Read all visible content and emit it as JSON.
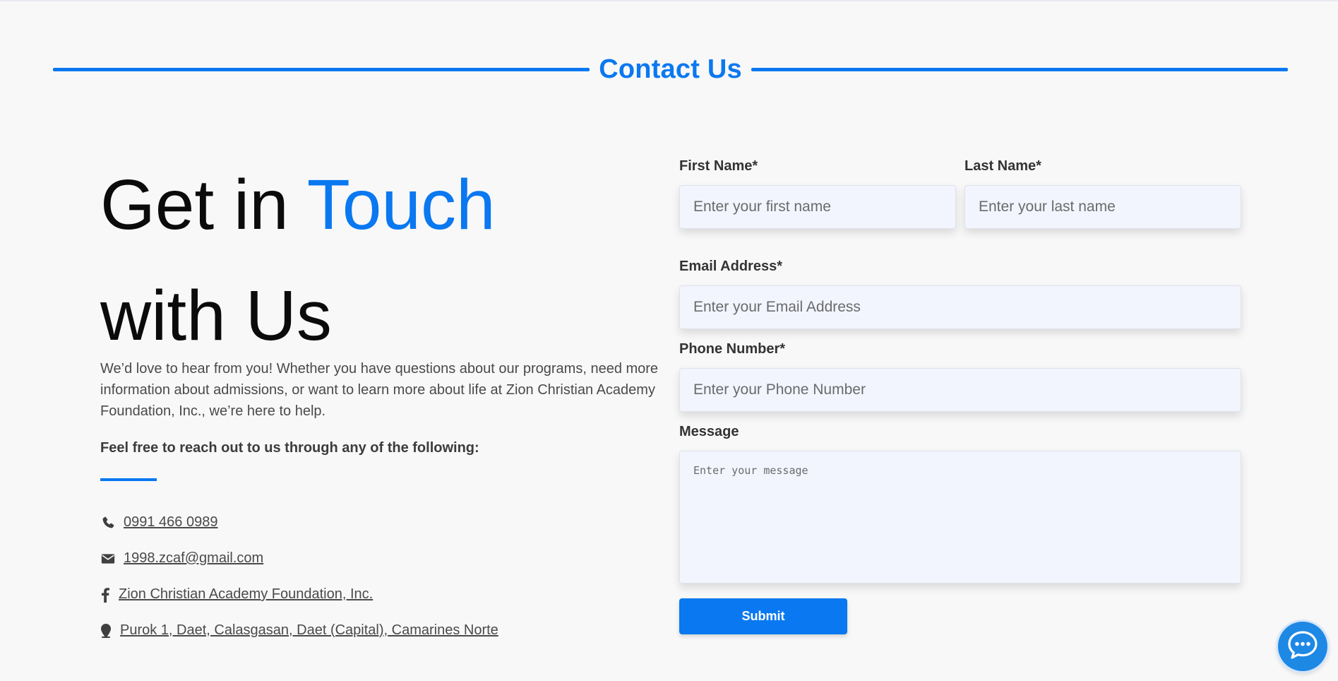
{
  "section": {
    "title": "Contact Us"
  },
  "hero": {
    "line1_plain": "Get in ",
    "line1_accent": "Touch",
    "line2": "with Us"
  },
  "intro": "We’d love to hear from you! Whether you have questions about our programs, need more information about admissions, or want to learn more about life at Zion Christian Academy Foundation, Inc., we’re here to help.",
  "reach_out": "Feel free to reach out to us through any of the following:",
  "contacts": [
    {
      "icon": "phone-icon",
      "text": "0991 466 0989"
    },
    {
      "icon": "envelope-icon",
      "text": "1998.zcaf@gmail.com"
    },
    {
      "icon": "facebook-icon",
      "text": "Zion Christian Academy Foundation, Inc."
    },
    {
      "icon": "map-pin-icon",
      "text": "Purok 1, Daet, Calasgasan, Daet (Capital), Camarines Norte"
    }
  ],
  "form": {
    "first_name": {
      "label": "First Name*",
      "placeholder": "Enter your first name",
      "value": ""
    },
    "last_name": {
      "label": "Last Name*",
      "placeholder": "Enter your last name",
      "value": ""
    },
    "email": {
      "label": "Email Address*",
      "placeholder": "Enter your Email Address",
      "value": ""
    },
    "phone": {
      "label": "Phone Number*",
      "placeholder": "Enter your Phone Number",
      "value": ""
    },
    "message": {
      "label": "Message",
      "placeholder": "Enter your message",
      "value": ""
    },
    "submit_label": "Submit"
  },
  "chat": {
    "icon": "chat-bubble-icon"
  },
  "colors": {
    "accent": "#0a78f0",
    "background": "#f8f8f8",
    "field_bg": "#f2f5fe",
    "chat": "#1e88e5"
  }
}
